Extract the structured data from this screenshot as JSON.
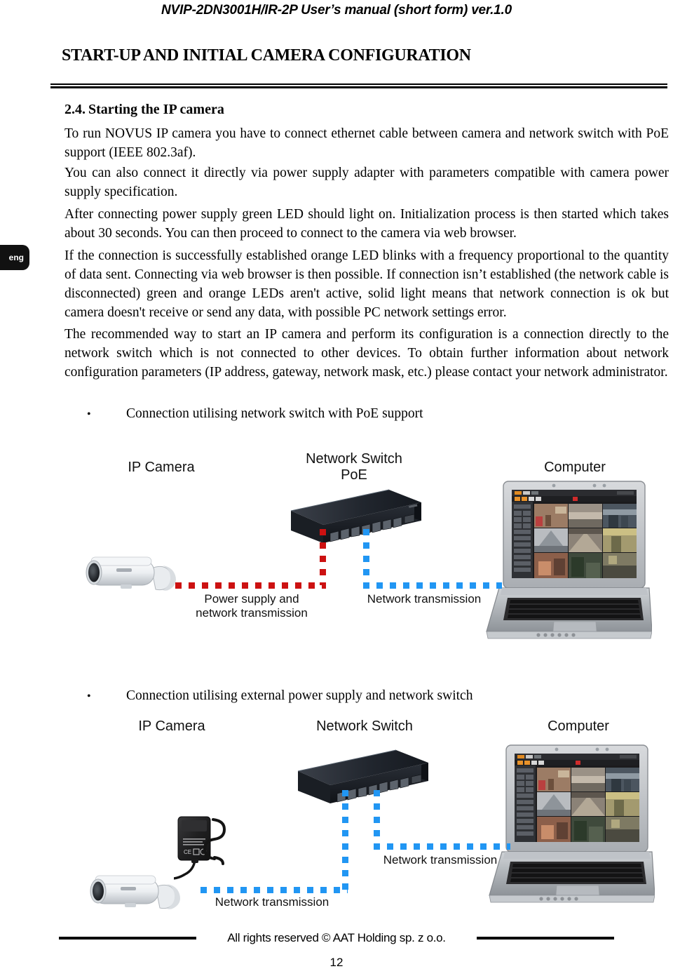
{
  "header": {
    "running_title": "NVIP-2DN3001H/IR-2P User’s manual (short form) ver.1.0"
  },
  "section": {
    "title": "START-UP AND INITIAL CAMERA CONFIGURATION"
  },
  "side_tab": {
    "language": "eng"
  },
  "content": {
    "subsection_number": "2.4.",
    "subsection_title": "Starting the IP camera",
    "paragraph_1": "To run NOVUS IP camera you have to connect ethernet cable between camera and network switch with PoE support  (IEEE 802.3af).",
    "paragraph_2": "You can also connect it directly via power supply adapter with parameters compatible with camera power supply specification.",
    "paragraph_3": "After connecting power supply green LED should light on. Initialization  process is then started which takes about 30 seconds. You can then proceed to connect to the camera via web browser.",
    "paragraph_4": "If the connection is successfully established orange LED  blinks with a frequency proportional to the quantity of data sent. Connecting via web browser is then possible. If connection isn’t established (the network cable is disconnected) green and orange LEDs aren't active, solid light means that network connection is ok but camera doesn't receive or send any data, with possible PC network settings error.",
    "paragraph_5": "The recommended way to start an IP camera and perform its configuration is a connection directly to the network switch which is not connected to other devices. To obtain further information about network configuration parameters (IP address, gateway, network mask, etc.) please   contact your network administrator.",
    "bullet_1": "Connection utilising network switch with PoE support",
    "bullet_2": "Connection utilising external power supply and network switch",
    "bullet_glyph": "•"
  },
  "diagram_poe": {
    "label_camera": "IP Camera",
    "label_switch_line1": "Network Switch",
    "label_switch_line2": "PoE",
    "label_computer": "Computer",
    "label_link_red_line1": "Power supply and",
    "label_link_red_line2": "network transmission",
    "label_link_blue": "Network transmission",
    "color_power_link": "#cc1111",
    "color_network_link": "#2196f3"
  },
  "diagram_external": {
    "label_camera": "IP Camera",
    "label_switch": "Network Switch",
    "label_computer": "Computer",
    "label_link_camera": "Network transmission",
    "label_link_computer": "Network transmission",
    "color_network_link": "#2196f3"
  },
  "footer": {
    "copyright": "All rights reserved © AAT Holding sp. z o.o.",
    "page_number": "12"
  }
}
